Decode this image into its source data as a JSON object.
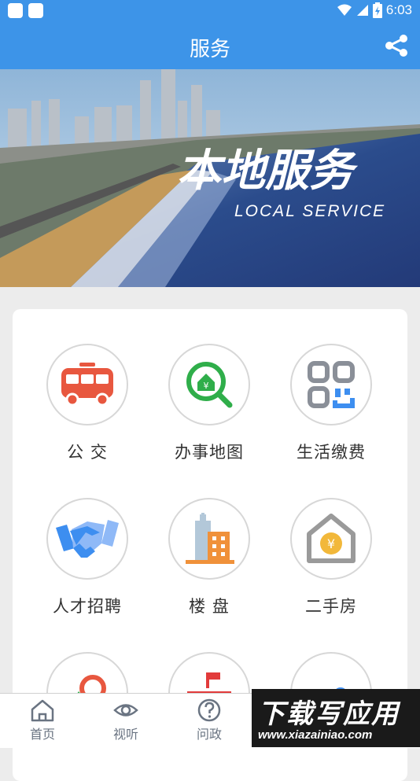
{
  "status_bar": {
    "time": "6:03"
  },
  "header": {
    "title": "服务",
    "share_icon": "share-icon"
  },
  "banner": {
    "title": "本地服务",
    "subtitle": "LOCAL SERVICE"
  },
  "services": [
    {
      "label": "公 交",
      "icon": "bus-icon",
      "color": "#e8573f"
    },
    {
      "label": "办事地图",
      "icon": "map-search-icon",
      "color": "#2fae4a"
    },
    {
      "label": "生活缴费",
      "icon": "qr-code-icon",
      "color": "#8a8f98"
    },
    {
      "label": "人才招聘",
      "icon": "handshake-icon",
      "color": "#3d8ef0"
    },
    {
      "label": "楼 盘",
      "icon": "building-icon",
      "color": "#f0913a"
    },
    {
      "label": "二手房",
      "icon": "house-icon",
      "color": "#f2b83a"
    }
  ],
  "tabs": [
    {
      "label": "首页",
      "icon": "home-icon"
    },
    {
      "label": "视听",
      "icon": "eye-icon"
    },
    {
      "label": "问政",
      "icon": "question-icon"
    }
  ],
  "watermark": {
    "title": "下载写应用",
    "url": "www.xiazainiao.com"
  }
}
